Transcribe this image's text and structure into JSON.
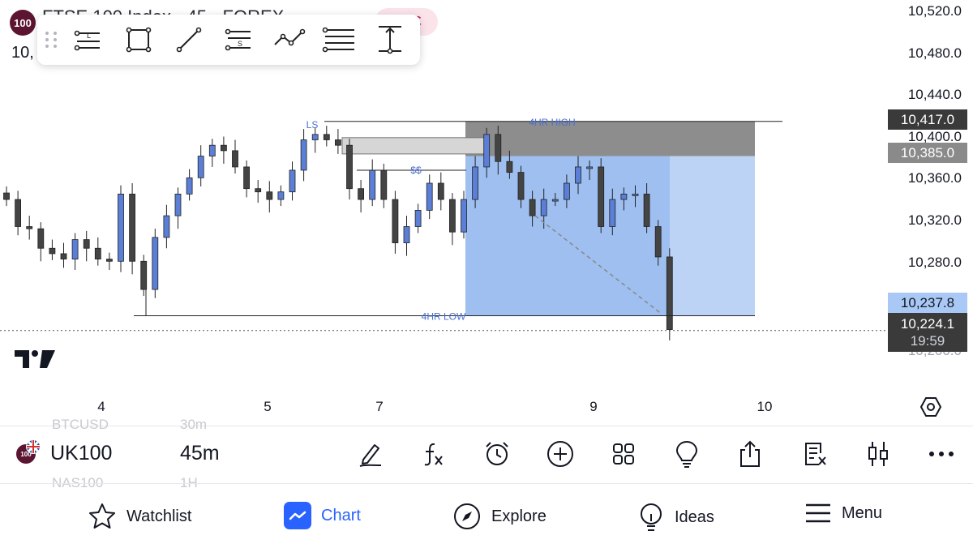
{
  "header": {
    "symbol_badge": "100",
    "title": "FTSE 100 Index · 45 · FOREX",
    "price_partial": "10,",
    "pill_glyph": "ε"
  },
  "toolbar": {
    "tools": [
      {
        "name": "long-position-tool",
        "label": "L"
      },
      {
        "name": "rectangle-tool"
      },
      {
        "name": "trend-line-tool"
      },
      {
        "name": "short-position-tool",
        "label": "S"
      },
      {
        "name": "path-tool"
      },
      {
        "name": "parallel-lines-tool"
      },
      {
        "name": "measure-tool"
      }
    ]
  },
  "price_axis": {
    "labels": [
      "10,520.0",
      "10,480.0",
      "10,440.0",
      "10,400.0",
      "10,360.0",
      "10,320.0",
      "10,280.0",
      "10,200.0"
    ],
    "tags": {
      "high": {
        "text": "10,417.0",
        "bg": "#3a3a3a",
        "color": "#ffffff"
      },
      "mid": {
        "text": "10,385.0",
        "bg": "#8a8a8a",
        "color": "#ffffff"
      },
      "low": {
        "text": "10,237.8",
        "bg": "#a9c8f5",
        "color": "#131722"
      },
      "last": {
        "text": "10,224.1",
        "countdown": "19:59",
        "bg": "#3a3a3a",
        "color": "#ffffff"
      }
    }
  },
  "time_axis": {
    "labels": [
      "4",
      "5",
      "7",
      "9",
      "10"
    ]
  },
  "annotations": {
    "hi_label": "4HR HIGH",
    "lo_label": "4HR LOW",
    "ls_label": "LS",
    "dollar_label": "$$"
  },
  "chart_data": {
    "type": "candlestick",
    "ylim": [
      10200,
      10520
    ],
    "levels": {
      "four_hr_high": 10417.0,
      "four_hr_low": 10237.8,
      "zone_bottom": 10385.0,
      "last": 10224.1
    },
    "candles_approx_close": [
      10345,
      10320,
      10318,
      10300,
      10295,
      10290,
      10308,
      10300,
      10290,
      10288,
      10350,
      10288,
      10262,
      10310,
      10330,
      10350,
      10365,
      10385,
      10395,
      10390,
      10375,
      10355,
      10352,
      10345,
      10352,
      10372,
      10400,
      10405,
      10400,
      10395,
      10355,
      10345,
      10372,
      10345,
      10305,
      10320,
      10335,
      10360,
      10345,
      10315,
      10345,
      10375,
      10405,
      10380,
      10370,
      10345,
      10330,
      10345,
      10345,
      10360,
      10375,
      10375,
      10320,
      10345,
      10350,
      10350,
      10320,
      10292,
      10225
    ]
  },
  "bottom_bar": {
    "symbol": "UK100",
    "symbol_badge": "100",
    "interval": "45m",
    "ghost_top": [
      "BTCUSD",
      "30m"
    ],
    "ghost_bottom": [
      "NAS100",
      "1H"
    ],
    "icons": [
      "draw-icon",
      "indicators-icon",
      "alert-icon",
      "add-icon",
      "layouts-icon",
      "ideas-bulb-icon",
      "share-icon",
      "object-tree-icon",
      "chart-type-icon",
      "more-icon"
    ]
  },
  "nav": {
    "items": [
      {
        "label": "Watchlist",
        "icon": "star-icon"
      },
      {
        "label": "Chart",
        "icon": "chart-icon",
        "active": true
      },
      {
        "label": "Explore",
        "icon": "compass-icon"
      },
      {
        "label": "Ideas",
        "icon": "bulb-icon"
      },
      {
        "label": "Menu",
        "icon": "menu-icon"
      }
    ]
  },
  "colors": {
    "accent": "#2962ff",
    "candle_up": "#5b7fd6",
    "candle_down": "#444444",
    "zone_blue": "#7fa9ec",
    "zone_grey": "#8d8d8d"
  }
}
